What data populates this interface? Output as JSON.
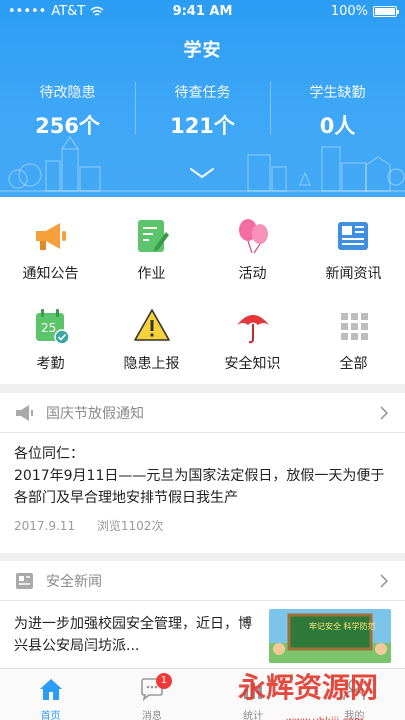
{
  "status": {
    "carrier": "AT&T",
    "time": "9:41 AM",
    "battery": "100%"
  },
  "header": {
    "title": "学安",
    "stats": [
      {
        "label": "待改隐患",
        "value": "256个"
      },
      {
        "label": "待查任务",
        "value": "121个"
      },
      {
        "label": "学生缺勤",
        "value": "0人"
      }
    ]
  },
  "grid": [
    {
      "label": "通知公告",
      "icon": "megaphone-icon"
    },
    {
      "label": "作业",
      "icon": "homework-icon"
    },
    {
      "label": "活动",
      "icon": "balloons-icon"
    },
    {
      "label": "新闻资讯",
      "icon": "newspaper-icon"
    },
    {
      "label": "考勤",
      "icon": "calendar-check-icon",
      "icon_text": "25"
    },
    {
      "label": "隐患上报",
      "icon": "warning-icon"
    },
    {
      "label": "安全知识",
      "icon": "umbrella-icon"
    },
    {
      "label": "全部",
      "icon": "grid-all-icon"
    }
  ],
  "notice": {
    "header": "国庆节放假通知",
    "greeting": "各位同仁：",
    "body": "2017年9月11日——元旦为国家法定假日，放假一天为便于各部门及早合理地安排节假日我生产",
    "date": "2017.9.11",
    "views": "浏览1102次"
  },
  "news": {
    "header": "安全新闻",
    "item_text": "为进一步加强校园安全管理，近日，博兴县公安局闫坊派...",
    "thumb_text": "牢记安全 科学防范"
  },
  "tabbar": {
    "tabs": [
      {
        "label": "首页",
        "icon": "home-icon"
      },
      {
        "label": "消息",
        "icon": "message-icon",
        "badge": "1"
      },
      {
        "label": "统计",
        "icon": "stats-icon"
      },
      {
        "label": "我的",
        "icon": "profile-icon"
      }
    ]
  },
  "watermark": {
    "text": "永辉资源网",
    "url": "www.yhkjjj.com"
  },
  "colors": {
    "primary": "#2c9df5",
    "badge": "#f03a3a",
    "accent_orange": "#f5a03a",
    "accent_green": "#52c27a"
  }
}
